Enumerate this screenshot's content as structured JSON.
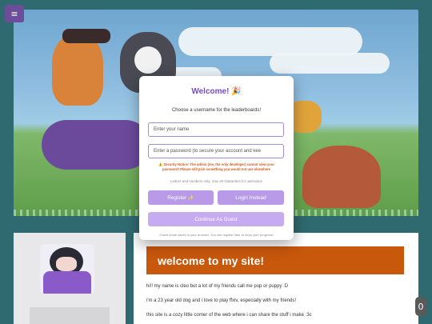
{
  "menu": {
    "icon": "hamburger-icon",
    "glyph": "≡"
  },
  "modal": {
    "title": "Welcome! 🎉",
    "subtitle": "Choose a username for the leaderboards!",
    "username_placeholder": "Enter your name",
    "password_placeholder": "Enter a password (to secure your account and kee",
    "security_notice": "⚠️ Security Notice: The admin (me, the only developer) cannot view your password! Please still pick something you would not use elsewhere",
    "hint": "Letters and numbers only, max 20 characters for username",
    "register_label": "Register ✨",
    "login_label": "Login Instead",
    "guest_label": "Continue As Guest",
    "footnote": "Guest mode saves in your browser. You can register later to keep your progress!",
    "accent_color": "#7a4bc8"
  },
  "page": {
    "heading": "welcome to my site!",
    "paragraphs": [
      "hi!! my name is cleo but a lot of my friends call me pup or puppy :D",
      "i'm a 23 year old dog and i love to play ffxiv, especially with my friends!",
      "this site is a cozy little corner of the web where i can share the stuff i make :3c"
    ],
    "heading_color": "#c8580c"
  },
  "counter": {
    "value": "0"
  }
}
